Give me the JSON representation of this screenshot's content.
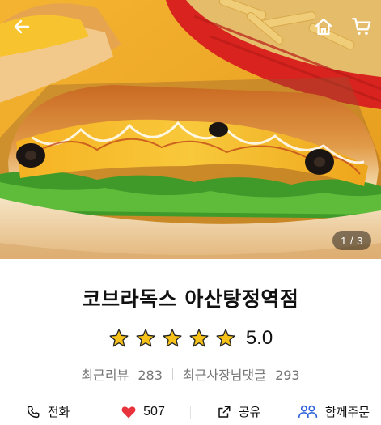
{
  "hero": {
    "image_description": "",
    "pager_current": "1",
    "pager_total": "3",
    "pager_text": "1 / 3"
  },
  "nav": {
    "back_icon": "arrow-left-icon",
    "home_icon": "home-icon",
    "cart_icon": "cart-icon"
  },
  "store": {
    "name": "코브라독스 아산탕정역점",
    "rating": "5.0",
    "stars_filled": 5,
    "stars_total": 5,
    "star_color": "#f6c21a"
  },
  "reviews": {
    "recent_reviews_label": "최근리뷰",
    "recent_reviews_count": "283",
    "owner_replies_label": "최근사장님댓글",
    "owner_replies_count": "293"
  },
  "actions": {
    "call_label": "전화",
    "like_count": "507",
    "share_label": "공유",
    "group_order_label": "함께주문",
    "heart_color": "#e8323c",
    "group_order_color": "#2b5fd9"
  }
}
